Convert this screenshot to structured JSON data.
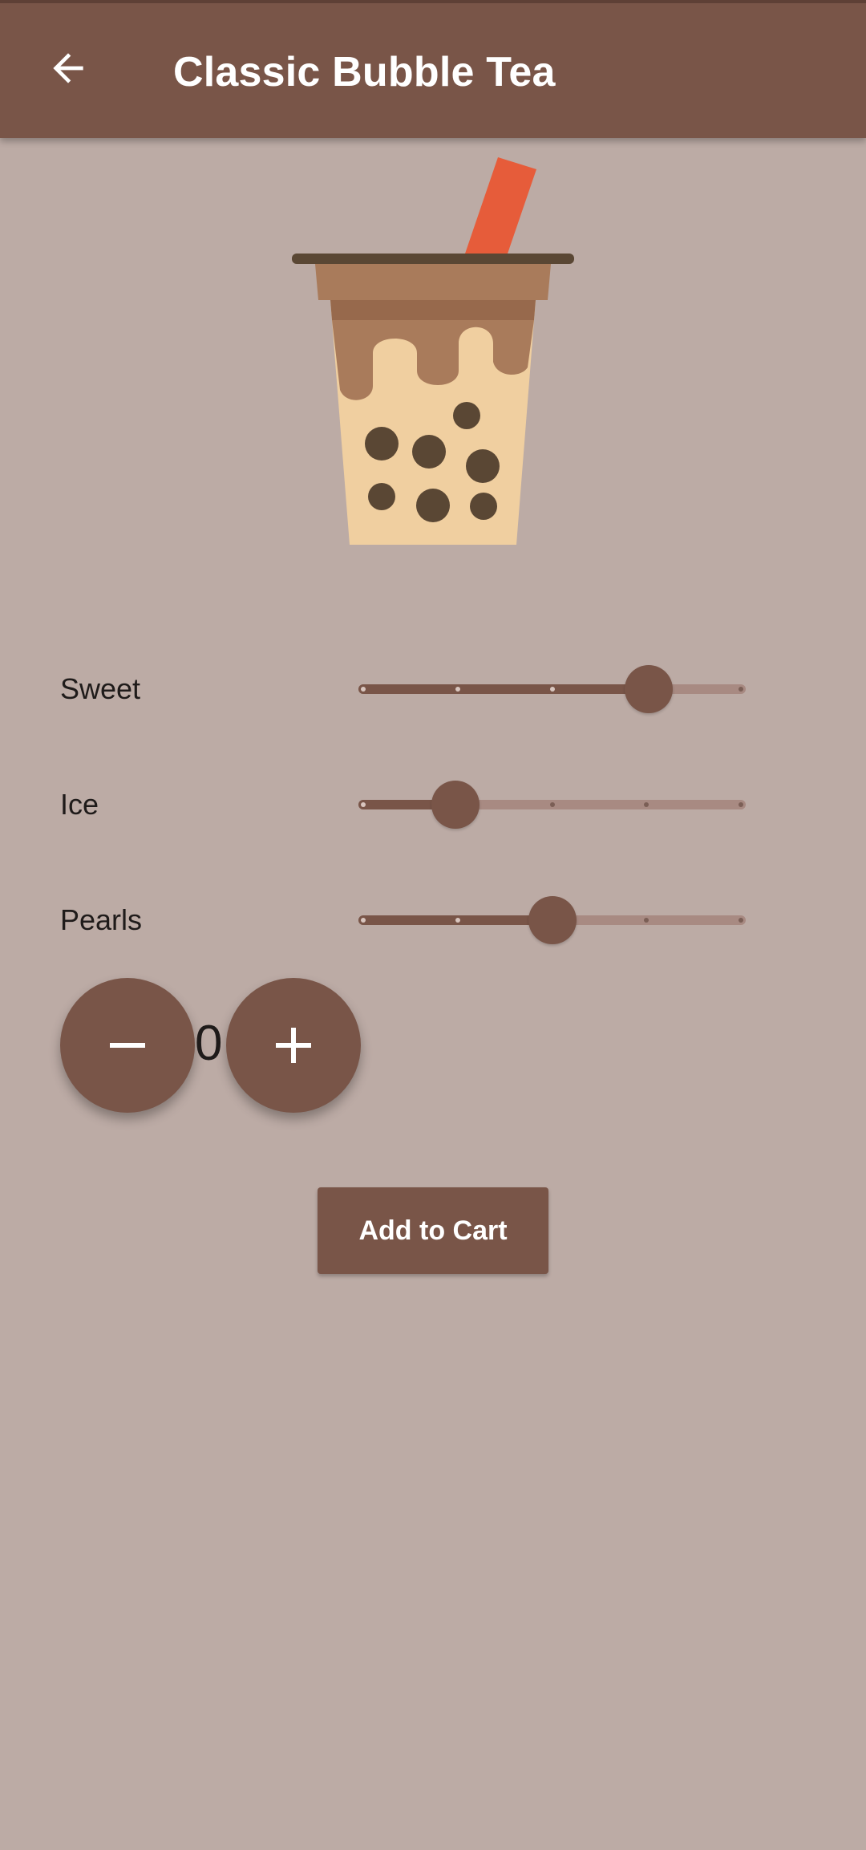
{
  "app_bar": {
    "title": "Classic Bubble Tea",
    "back_icon": "arrow-back-icon"
  },
  "colors": {
    "primary": "#795548",
    "background": "#bcaba5",
    "straw": "#e65c3a",
    "tea": "#a97b5b",
    "milk": "#f0cfa0",
    "pearl": "#5a4734"
  },
  "image": {
    "icon": "bubble-tea-cup-illustration"
  },
  "sliders": [
    {
      "label": "Sweet",
      "value": 3,
      "min": 0,
      "max": 4
    },
    {
      "label": "Ice",
      "value": 1,
      "min": 0,
      "max": 4
    },
    {
      "label": "Pearls",
      "value": 2,
      "min": 0,
      "max": 4
    }
  ],
  "quantity": {
    "value": "0",
    "decrement_icon": "minus-icon",
    "increment_icon": "plus-icon"
  },
  "cart_button": {
    "label": "Add to Cart"
  }
}
